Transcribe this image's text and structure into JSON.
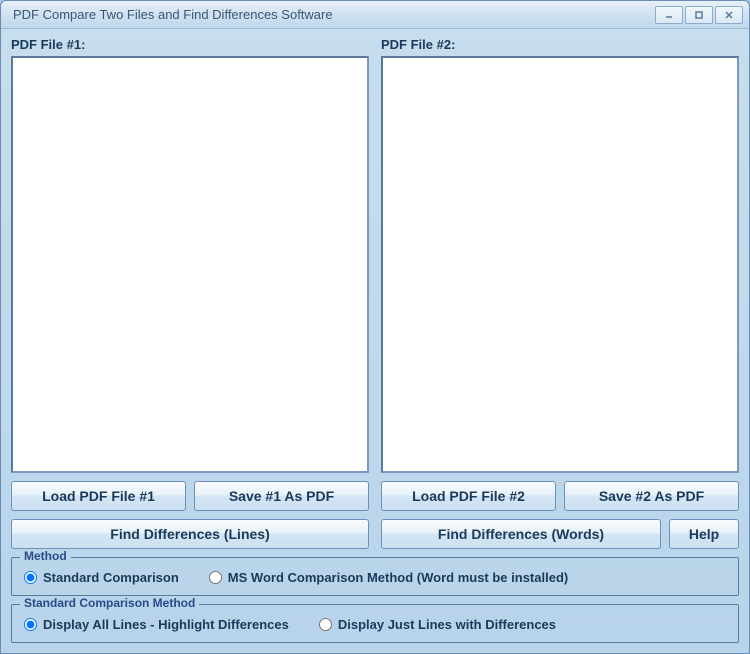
{
  "window": {
    "title": "PDF Compare Two Files and Find Differences Software"
  },
  "panels": {
    "file1_label": "PDF File #1:",
    "file2_label": "PDF File #2:"
  },
  "buttons": {
    "load1": "Load PDF File #1",
    "save1": "Save #1 As PDF",
    "load2": "Load PDF File #2",
    "save2": "Save #2 As PDF",
    "find_lines": "Find Differences (Lines)",
    "find_words": "Find Differences (Words)",
    "help": "Help"
  },
  "method_group": {
    "legend": "Method",
    "options": {
      "standard": "Standard Comparison",
      "msword": "MS Word Comparison Method (Word must be installed)"
    },
    "selected": "standard"
  },
  "compare_group": {
    "legend": "Standard Comparison Method",
    "options": {
      "display_all": "Display All Lines - Highlight Differences",
      "display_diff": "Display Just Lines with Differences"
    },
    "selected": "display_all"
  }
}
